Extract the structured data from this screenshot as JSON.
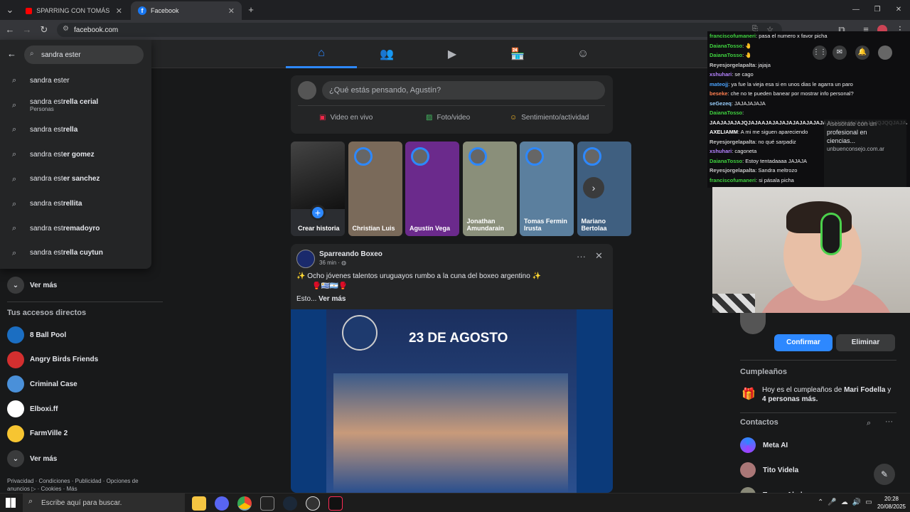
{
  "tabs": [
    {
      "title": "SPARRING CON TOMÁS MAZZ..."
    },
    {
      "title": "Facebook"
    }
  ],
  "address": {
    "url": "facebook.com"
  },
  "search": {
    "query": "sandra ester",
    "results": [
      {
        "text": "sandra ester",
        "sub": ""
      },
      {
        "text": "sandra estrella cerial",
        "sub": "Personas"
      },
      {
        "text": "sandra estrella",
        "sub": ""
      },
      {
        "text": "sandra ester gomez",
        "sub": ""
      },
      {
        "text": "sandra ester sanchez",
        "sub": ""
      },
      {
        "text": "sandra estrellita",
        "sub": ""
      },
      {
        "text": "sandra estremadoyro",
        "sub": ""
      },
      {
        "text": "sandra estrella cuytun",
        "sub": ""
      }
    ]
  },
  "left": {
    "ver_mas_1": "Ver más",
    "shortcuts_title": "Tus accesos directos",
    "shortcuts": [
      {
        "label": "8 Ball Pool",
        "color": "#1b6ec2"
      },
      {
        "label": "Angry Birds Friends",
        "color": "#d32f2f"
      },
      {
        "label": "Criminal Case",
        "color": "#4a90d9"
      },
      {
        "label": "Elboxi.ff",
        "color": "#ffffff"
      },
      {
        "label": "FarmVille 2",
        "color": "#f7c531"
      }
    ],
    "ver_mas_2": "Ver más",
    "footer1": "Privacidad · Condiciones · Publicidad · Opciones de",
    "footer2": "anuncios ▷ · Cookies · Más"
  },
  "composer": {
    "placeholder": "¿Qué estás pensando, Agustín?",
    "live": "Video en vivo",
    "photo": "Foto/video",
    "feeling": "Sentimiento/actividad"
  },
  "stories": [
    {
      "name": "Crear historia",
      "color": "#2b2d31"
    },
    {
      "name": "Christian Luis",
      "color": "#7a6a5a"
    },
    {
      "name": "Agustín Vega",
      "color": "#6b2a8c"
    },
    {
      "name": "Jonathan Amundarain",
      "color": "#8a8f7a"
    },
    {
      "name": "Tomas Fermin Irusta",
      "color": "#5b7f9e"
    },
    {
      "name": "Mariano Bertolaa",
      "color": "#3f5f80"
    }
  ],
  "post": {
    "page": "Sparreando Boxeo",
    "time": "36 min · ",
    "text": "✨ Ocho jóvenes talentos uruguayos rumbo a la cuna del boxeo argentino ✨",
    "emoji_line": "🥊🇺🇾🇦🇷🥊",
    "more_prefix": "Esto... ",
    "more": "Ver más",
    "image_title": "23 DE AGOSTO"
  },
  "chat": [
    {
      "user": "franciscofumaneri",
      "color": "#3fd13f",
      "msg": ": pasa el numero x favor picha"
    },
    {
      "user": "DaianaTosso",
      "color": "#3fd13f",
      "msg": ": 🤚"
    },
    {
      "user": "DaianaTosso",
      "color": "#3fd13f",
      "msg": ": 🤚"
    },
    {
      "user": "Reyesjorgelapalta",
      "color": "#c9c9c9",
      "msg": ": jajaja"
    },
    {
      "user": "xshuhari",
      "color": "#b583ff",
      "msg": ": se cago"
    },
    {
      "user": "mateojj",
      "color": "#4aa3ff",
      "msg": ": ya fue la vieja esa si en unos dias le agarra un paro"
    },
    {
      "user": "beseke",
      "color": "#ff7f50",
      "msg": ": che no te pueden banear por mostrar info personal?"
    },
    {
      "user": "seGezeq",
      "color": "#9ad0ff",
      "msg": ": JAJAJAJAJA"
    },
    {
      "user": "DaianaTosso",
      "color": "#3fd13f",
      "msg": ":"
    },
    {
      "user": "",
      "color": "#ffffff",
      "msg": "JAAJAJAJAJQJAJAAJAJAJAJAJAJAJAJAJAJAJJAAJAJAJAJAJQJQQJAJAJAQJ"
    },
    {
      "user": "AXELIAMM",
      "color": "#ffffff",
      "msg": ": A mi me siguen apareciendo"
    },
    {
      "user": "Reyesjorgelapalta",
      "color": "#c9c9c9",
      "msg": ": no qué sarpadiz"
    },
    {
      "user": "xshuhari",
      "color": "#b583ff",
      "msg": ": cagoneta"
    },
    {
      "user": "DaianaTosso",
      "color": "#3fd13f",
      "msg": ": Estoy tentadaaaa JAJAJA"
    },
    {
      "user": "Reyesjorgelapalta",
      "color": "#c9c9c9",
      "msg": ": Sandra meltrozo"
    },
    {
      "user": "franciscofumaneri",
      "color": "#3fd13f",
      "msg": ": si pásala picha"
    }
  ],
  "ad": {
    "line1": "Asesórate con un",
    "line2": "profesional en",
    "line3": "ciencias...",
    "domain": "unbuenconsejo.com.ar"
  },
  "right": {
    "confirm": "Confirmar",
    "delete": "Eliminar",
    "birthdays_title": "Cumpleaños",
    "bday_pre": "Hoy es el cumpleaños de ",
    "bday_name": "Mari Fodella",
    "bday_post": " y",
    "bday_more": "4 personas más.",
    "contacts_title": "Contactos",
    "contacts": [
      {
        "name": "Meta AI"
      },
      {
        "name": "Tito Videla"
      },
      {
        "name": "Tomas Aledro"
      }
    ]
  },
  "taskbar": {
    "search": "Escribe aquí para buscar.",
    "time": "20:28",
    "date": "20/08/2025"
  },
  "colors": {
    "accent": "#2d88ff",
    "bg": "#18191a",
    "card": "#242526"
  }
}
